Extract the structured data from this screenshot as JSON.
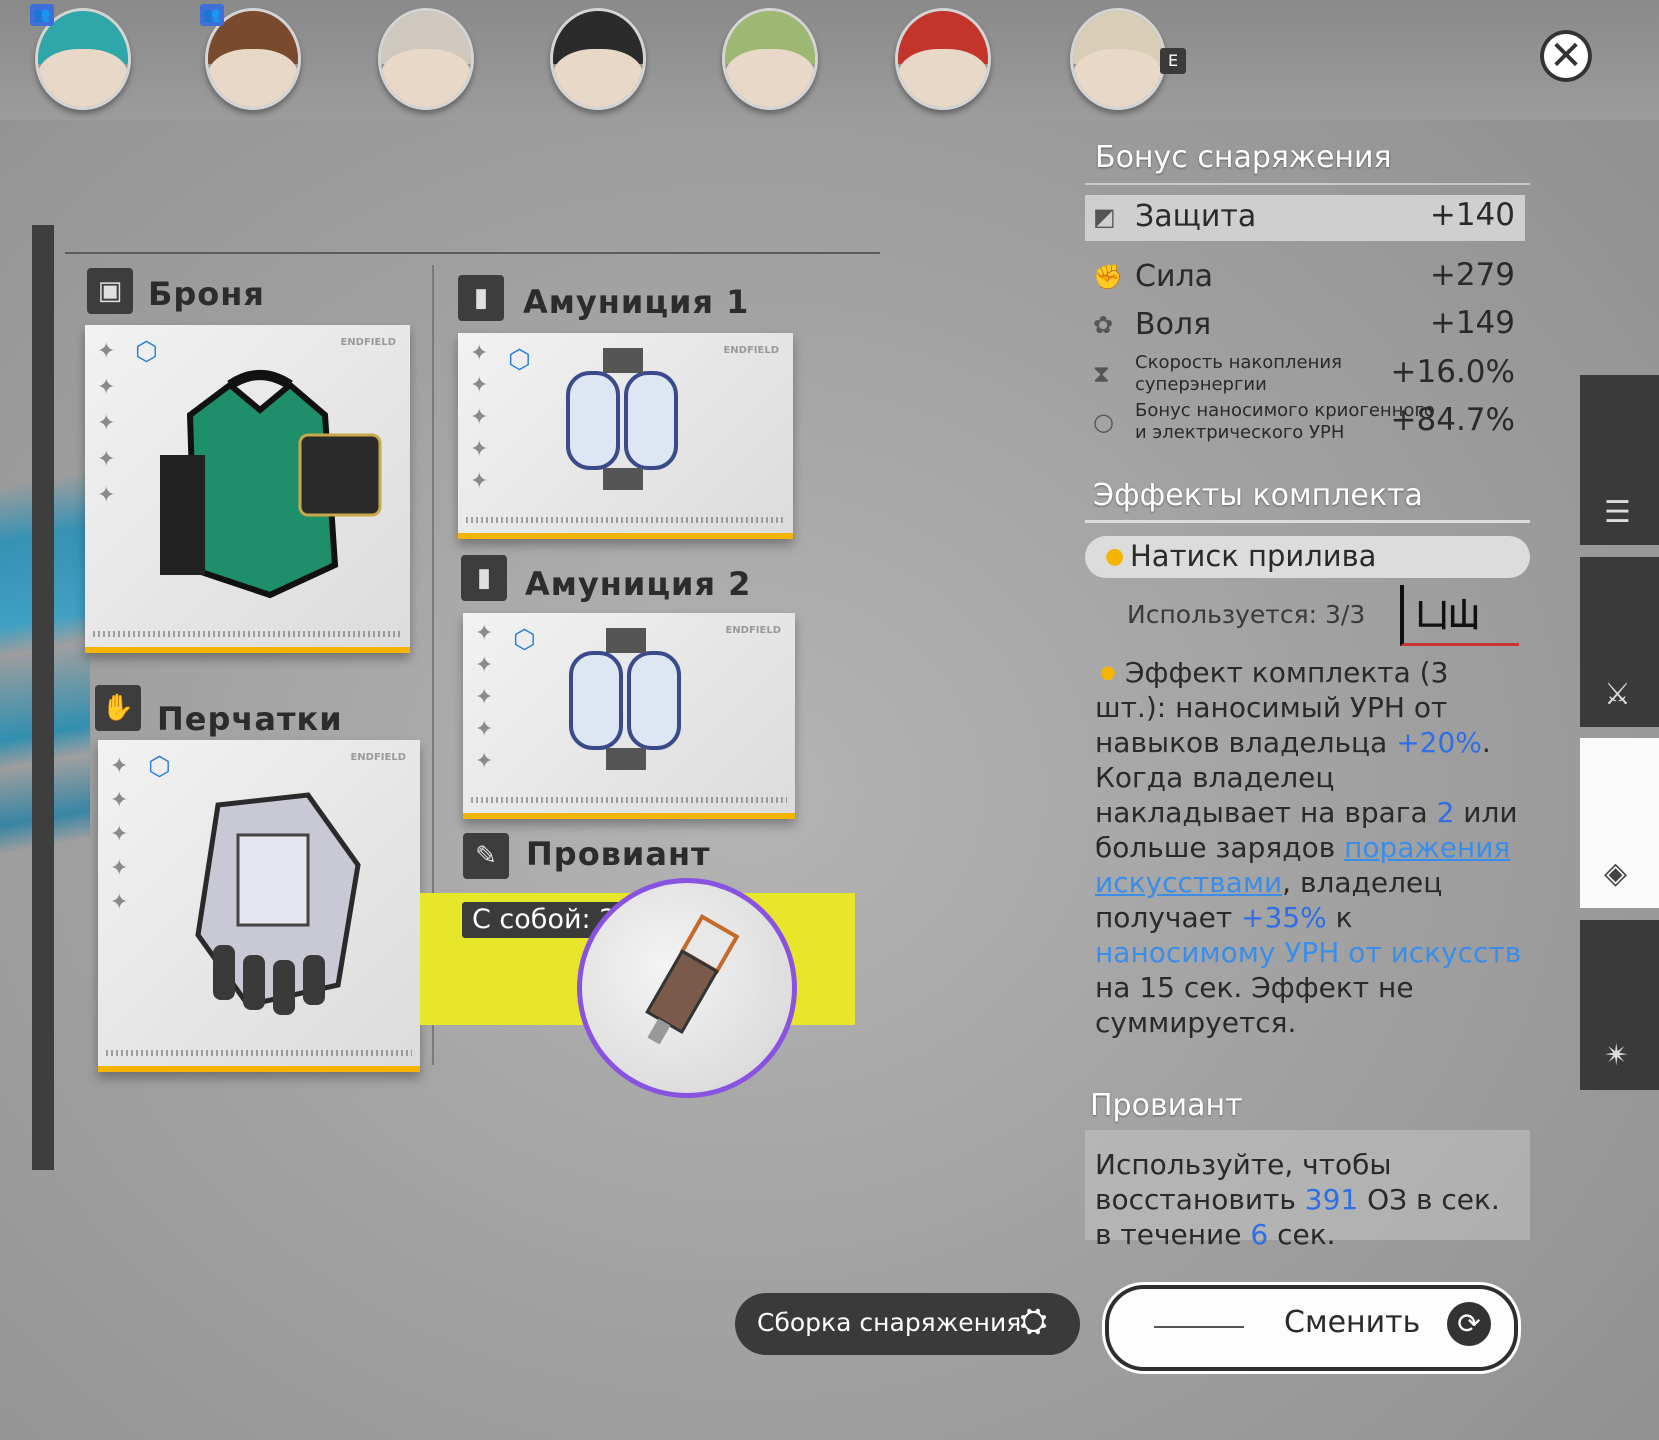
{
  "party": {
    "hotkey": "E",
    "members": [
      {
        "icon": "character-portrait-icon",
        "badge": "party-icon",
        "hair": "#2fa7a9"
      },
      {
        "icon": "character-portrait-icon",
        "badge": "party-icon",
        "hair": "#7a4a2e"
      },
      {
        "icon": "character-portrait-icon",
        "badge": "",
        "hair": "#cfc8bf"
      },
      {
        "icon": "character-portrait-icon",
        "badge": "",
        "hair": "#2b2b2b"
      },
      {
        "icon": "character-portrait-icon",
        "badge": "",
        "hair": "#9cb872"
      },
      {
        "icon": "character-portrait-icon",
        "badge": "",
        "hair": "#c3342a"
      },
      {
        "icon": "character-portrait-icon",
        "badge": "",
        "hair": "#d8cdb6"
      }
    ]
  },
  "slots": {
    "armor": {
      "label": "Броня",
      "brand": "ENDFIELD"
    },
    "gloves": {
      "label": "Перчатки",
      "brand": "ENDFIELD"
    },
    "ammo1": {
      "label": "Амуниция 1",
      "brand": "ENDFIELD"
    },
    "ammo2": {
      "label": "Амуниция 2",
      "brand": "ENDFIELD"
    },
    "food": {
      "label": "Провиант",
      "carried": "С собой: 243"
    }
  },
  "bonus": {
    "title": "Бонус снаряжения",
    "stats": [
      {
        "name": "Защита",
        "value": "+140",
        "icon": "shield-icon"
      },
      {
        "name": "Сила",
        "value": "+279",
        "icon": "fist-icon"
      },
      {
        "name": "Воля",
        "value": "+149",
        "icon": "brain-icon"
      },
      {
        "name": "Скорость накопления суперэнергии",
        "value": "+16.0%",
        "icon": "hourglass-icon"
      },
      {
        "name": "Бонус наносимого криогенного и электрического УРН",
        "value": "+84.7%",
        "icon": "dot-icon"
      }
    ]
  },
  "set": {
    "title": "Эффекты комплекта",
    "name": "Натиск прилива",
    "usage": "Используется: 3/3",
    "desc_1": "Эффект комплекта (3 шт.): наносимый УРН от навыков владельца ",
    "val_1": "+20%",
    "desc_2": ". Когда владелец накладывает на врага ",
    "val_2": "2",
    "desc_3": " или больше зарядов ",
    "link_1": "поражения искусствами",
    "desc_4": ", владелец получает ",
    "val_3": "+35%",
    "desc_5": " к ",
    "link_2": "наносимому УРН от искусств",
    "desc_6": " на 15 сек. Эффект не суммируется."
  },
  "food_info": {
    "title": "Провиант",
    "desc_1": "Используйте, чтобы восстановить ",
    "val_1": "391",
    "desc_2": " ОЗ в сек. в течение ",
    "val_2": "6",
    "desc_3": " сек."
  },
  "actions": {
    "assemble": "Сборка снаряжения",
    "swap": "Сменить"
  },
  "colors": {
    "accent_yellow": "#f4b400",
    "food_band": "#e8e62a",
    "link_blue": "#3a8eea",
    "food_ring": "#8a52e0"
  }
}
